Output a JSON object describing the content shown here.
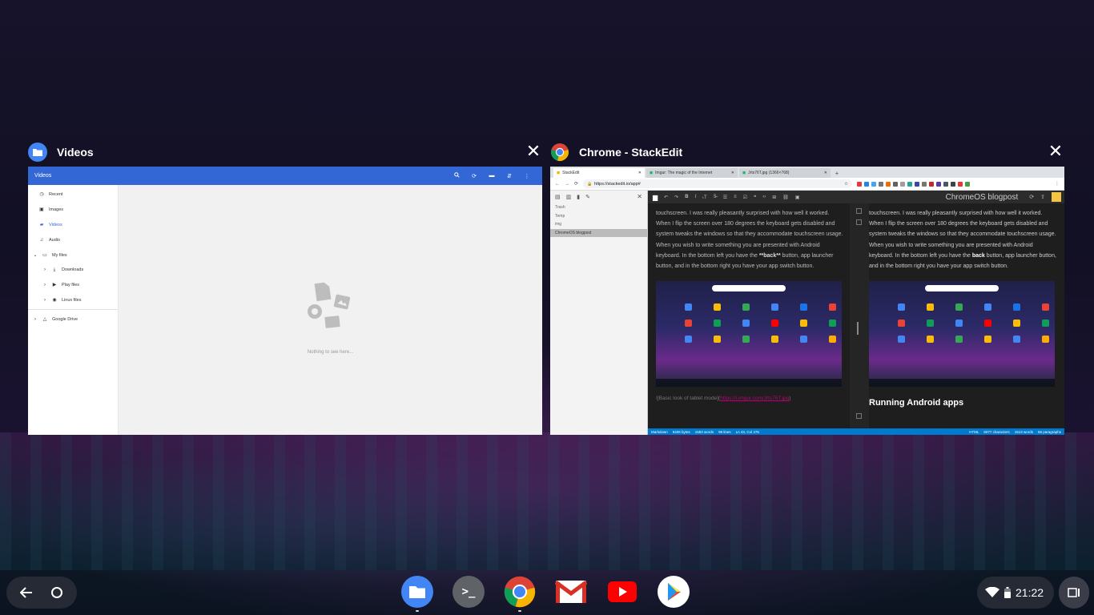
{
  "windows": [
    {
      "title": "Videos",
      "app_icon": "files-app-icon",
      "files": {
        "title": "Videos",
        "sidebar": [
          {
            "label": "Recent",
            "icon": "clock-icon"
          },
          {
            "label": "Images",
            "icon": "image-icon"
          },
          {
            "label": "Videos",
            "icon": "video-icon",
            "active": true
          },
          {
            "label": "Audio",
            "icon": "audio-icon"
          },
          {
            "label": "My files",
            "icon": "laptop-icon"
          },
          {
            "label": "Downloads",
            "icon": "download-icon"
          },
          {
            "label": "Play files",
            "icon": "play-icon"
          },
          {
            "label": "Linux files",
            "icon": "linux-icon"
          },
          {
            "label": "Google Drive",
            "icon": "drive-icon"
          }
        ],
        "empty_text": "Nothing to see here..."
      }
    },
    {
      "title": "Chrome - StackEdit",
      "app_icon": "chrome-icon",
      "chrome": {
        "tabs": [
          {
            "label": "StackEdit"
          },
          {
            "label": "Imgur: The magic of the Internet"
          },
          {
            "label": "Jrts76T.jpg (1366×768)"
          }
        ],
        "url": "https://stackedit.io/app#",
        "stackedit": {
          "files": [
            "Trash",
            "Temp",
            "img",
            "ChromeOS blogpost"
          ],
          "doc_title": "ChromeOS blogpost",
          "editor_text_pre": "touchscreen. I was really pleasantly surprised with how well it worked. When I flip the screen over 180 degrees the keyboard gets disabled and system tweaks the windows so that they accommodate touchscreen usage. When you wish to write something you are presented with Android keyboard. In the bottom left you have the ",
          "editor_bold": "**back**",
          "editor_text_post": " button, app launcher button, and in the bottom right you have your app switch button.",
          "editor_link_text": "![Basic look of tablet mode](",
          "editor_link_url": "https://i.imgur.com/Jrts76T.jpg",
          "editor_link_close": ")",
          "preview_text_pre": "touchscreen. I was really pleasantly surprised with how well it worked. When I flip the screen over 180 degrees the keyboard gets disabled and system tweaks the windows so that they accommodate touchscreen usage. When you wish to write something you are presented with Android keyboard. In the bottom left you have the ",
          "preview_bold": "back",
          "preview_text_post": " button, app launcher button, and in the bottom right you have your app switch button.",
          "preview_heading": "Running Android apps",
          "status_left": [
            "Markdown",
            "9406 bytes",
            "1583 words",
            "99 lines",
            "Ln 43, Col 476"
          ],
          "status_right": [
            "HTML",
            "6077 characters",
            "1513 words",
            "56 paragraphs"
          ]
        }
      }
    }
  ],
  "shelf": {
    "apps": [
      "files-app-icon",
      "terminal-icon",
      "chrome-icon",
      "gmail-icon",
      "youtube-icon",
      "play-store-icon"
    ],
    "terminal_glyph": ">_",
    "clock": "21:22"
  }
}
